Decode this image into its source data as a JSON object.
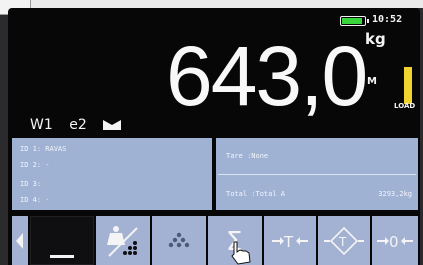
{
  "status": {
    "time": "10:52",
    "battery_level": 0.9,
    "battery_color": "#37d43c"
  },
  "display": {
    "weight": "643,0",
    "unit": "kg",
    "mode_label": "M",
    "load_label": "LOAD",
    "load_level": 0.55,
    "load_color": "#f1d330"
  },
  "status_bar": {
    "weighing_range": "W1",
    "interval": "e2",
    "stable_icon": "stable-indicator-icon"
  },
  "ids": [
    "ID 1: RAVAS",
    "ID 2: -",
    "ID 3:",
    "ID 4: -"
  ],
  "tare": {
    "label": "Tare :None"
  },
  "total": {
    "label": "Total :Total A",
    "value": "3293,2kg"
  },
  "softkeys": [
    {
      "name": "scroll-left-button",
      "icon": "arrow-left-icon"
    },
    {
      "name": "zero-tracking-button",
      "icon": "blank-underscore-icon"
    },
    {
      "name": "piece-count-button",
      "icon": "weight-divide-icon"
    },
    {
      "name": "counting-button",
      "icon": "dots-pyramid-icon"
    },
    {
      "name": "total-sum-button",
      "icon": "sigma-icon"
    },
    {
      "name": "tare-button",
      "icon": "tare-icon"
    },
    {
      "name": "preset-tare-button",
      "icon": "preset-tare-icon"
    },
    {
      "name": "zero-button",
      "icon": "zero-icon"
    }
  ],
  "colors": {
    "panel": "#9fb2d4",
    "key": "#a3b1d2",
    "screen": "#070708"
  }
}
